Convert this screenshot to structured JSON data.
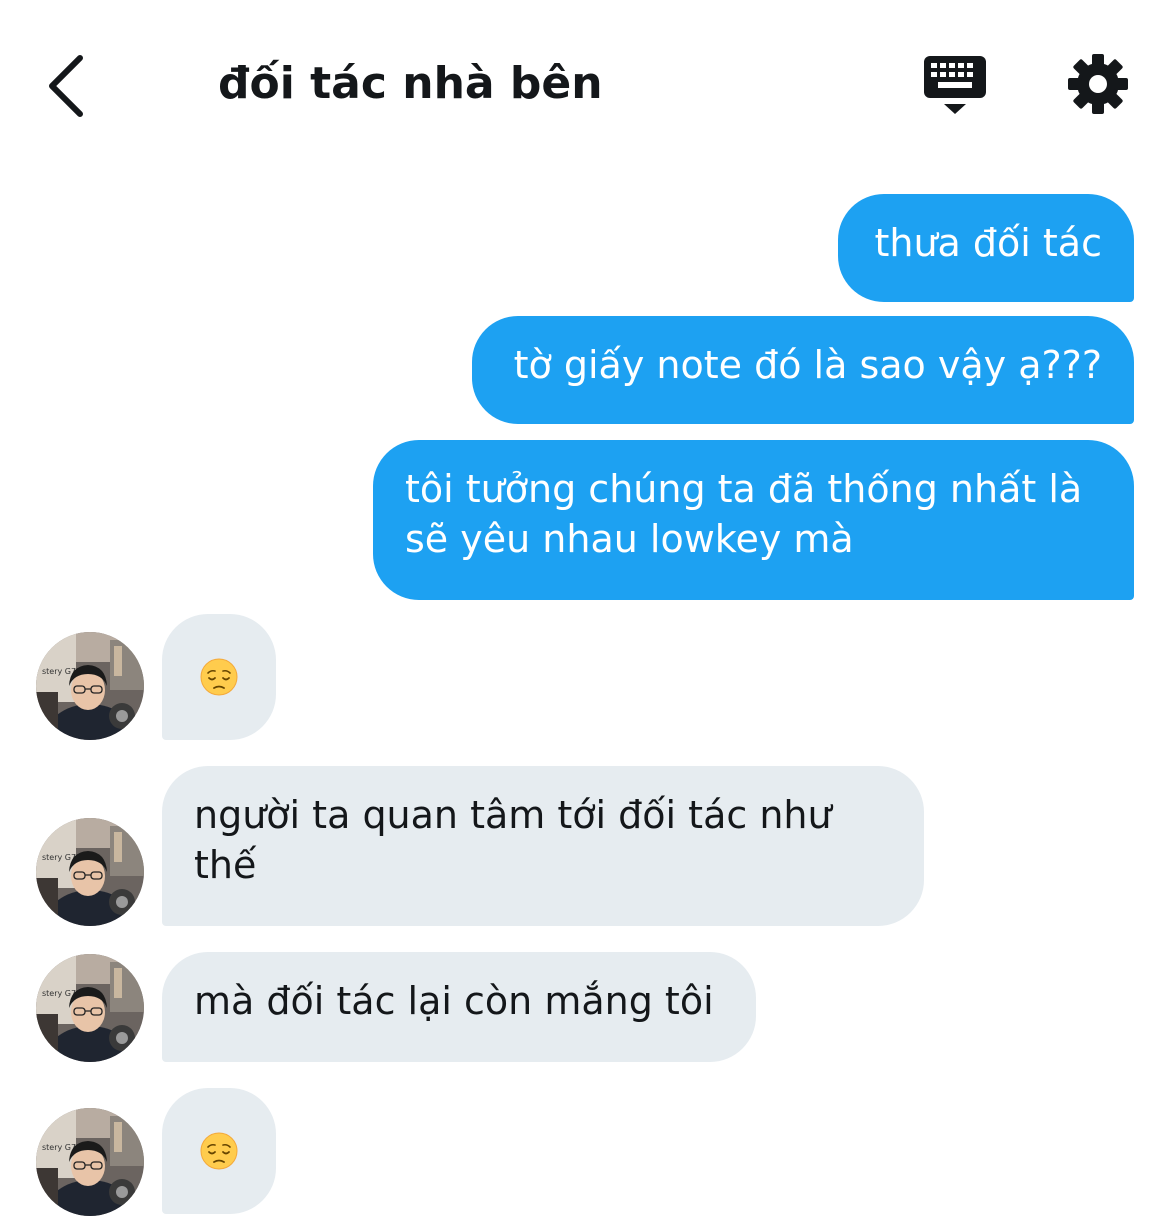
{
  "header": {
    "title": "đối tác nhà bên",
    "back_icon": "chevron-left-icon",
    "keyboard_icon": "keyboard-icon",
    "settings_icon": "gear-icon"
  },
  "messages": [
    {
      "direction": "out",
      "text": "thưa đối tác"
    },
    {
      "direction": "out",
      "text": "tờ giấy note đó là sao vậy ạ???"
    },
    {
      "direction": "out",
      "lines": [
        "tôi tưởng chúng ta đã thống nhất là",
        "sẽ yêu nhau lowkey mà"
      ]
    },
    {
      "direction": "in",
      "emoji": "pensive-face"
    },
    {
      "direction": "in",
      "lines": [
        "người ta quan tâm tới đối tác như",
        "thế"
      ]
    },
    {
      "direction": "in",
      "text": "mà đối tác lại còn mắng tôi"
    },
    {
      "direction": "in",
      "emoji": "pensive-face"
    }
  ],
  "colors": {
    "outgoing_bubble": "#1da1f2",
    "incoming_bubble": "#e6ecf0",
    "text_dark": "#14171a"
  }
}
